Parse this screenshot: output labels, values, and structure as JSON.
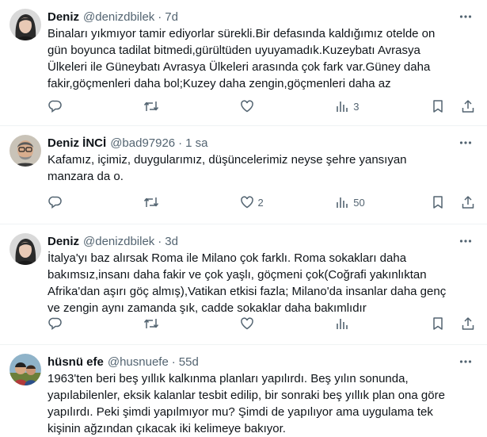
{
  "tweets": [
    {
      "name": "Deniz",
      "handle": "@denizdbilek",
      "time": "7d",
      "text": "Binaları yıkmıyor tamir ediyorlar sürekli.Bir defasında kaldığımız otelde on\ngün boyunca tadilat bitmedi,gürültüden uyuyamadık.Kuzeybatı Avrasya\nÜlkeleri ile Güneybatı Avrasya Ülkeleri arasında çok fark var.Güney daha\nfakir,göçmenleri daha bol;Kuzey daha zengin,göçmenleri daha az",
      "replies": "",
      "retweets": "",
      "likes": "",
      "views": "3"
    },
    {
      "name": "Deniz İNCİ",
      "handle": "@bad97926",
      "time": "1 sa",
      "text": "Kafamız, içimiz, duygularımız, düşüncelerimiz neyse şehre yansıyan\nmanzara da o.",
      "replies": "",
      "retweets": "",
      "likes": "2",
      "views": "50"
    },
    {
      "name": "Deniz",
      "handle": "@denizdbilek",
      "time": "3d",
      "text": "İtalya'yı baz alırsak Roma ile Milano çok farklı. Roma sokakları daha\nbakımsız,insanı daha fakir ve çok yaşlı, göçmeni çok(Coğrafi yakınlıktan\nAfrika'dan aşırı göç almış),Vatikan etkisi fazla; Milano'da insanlar daha genç\nve zengin aynı zamanda şık, cadde sokaklar daha bakımlıdır",
      "replies": "",
      "retweets": "",
      "likes": "",
      "views": ""
    },
    {
      "name": "hüsnü efe",
      "handle": "@husnuefe",
      "time": "55d",
      "text": "1963'ten beri beş yıllık kalkınma planları yapılırdı. Beş yılın sonunda,\nyapılabilenler, eksik kalanlar tesbit edilip, bir sonraki beş yıllık plan ona göre\nyapılırdı. Peki şimdi yapılmıyor mu? Şimdi de yapılıyor ama uygulama tek\nkişinin ağzından çıkacak iki kelimeye bakıyor."
    }
  ],
  "dot": "·",
  "colors": {
    "text": "#0f1419",
    "muted": "#536471",
    "border": "#eff3f4"
  },
  "icons": [
    "more-icon",
    "reply-icon",
    "retweet-icon",
    "like-icon",
    "views-icon",
    "bookmark-icon",
    "share-icon"
  ]
}
